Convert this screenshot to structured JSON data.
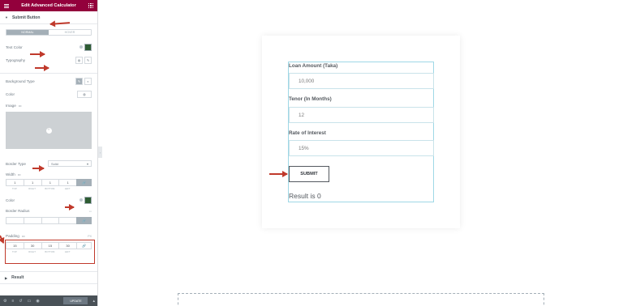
{
  "panel": {
    "title": "Edit Advanced Calculator",
    "section_submit": "Submit Button",
    "tabs": [
      "NORMAL",
      "HOVER"
    ],
    "text_color_label": "Text Color",
    "typography_label": "Typography",
    "background_type_label": "Background Type",
    "color_label": "Color",
    "image_label": "Image",
    "border_type_label": "Border Type",
    "border_type_value": "Solid",
    "width_label": "Width",
    "width_values": [
      "1",
      "1",
      "1",
      "1"
    ],
    "dim_labels": [
      "Top",
      "Right",
      "Bottom",
      "Left"
    ],
    "border_color_label": "Color",
    "border_radius_label": "Border Radius",
    "padding_label": "Padding",
    "padding_values": [
      "15",
      "30",
      "15",
      "30"
    ],
    "unit_label": "PX",
    "section_result": "Result",
    "update_label": "Update",
    "colors": {
      "text_color_swatch": "#2e5c33",
      "border_color_swatch": "#2e5c33",
      "header_bg": "#93003c",
      "annotation_arrow": "#c0392b"
    }
  },
  "calculator": {
    "loan_label": "Loan Amount (Taka)",
    "loan_value": "10,000",
    "tenor_label": "Tenor (In Months)",
    "tenor_value": "12",
    "rate_label": "Rate of Interest",
    "rate_value": "15%",
    "submit_label": "SUBMIT",
    "result_text": "Result is 0"
  }
}
